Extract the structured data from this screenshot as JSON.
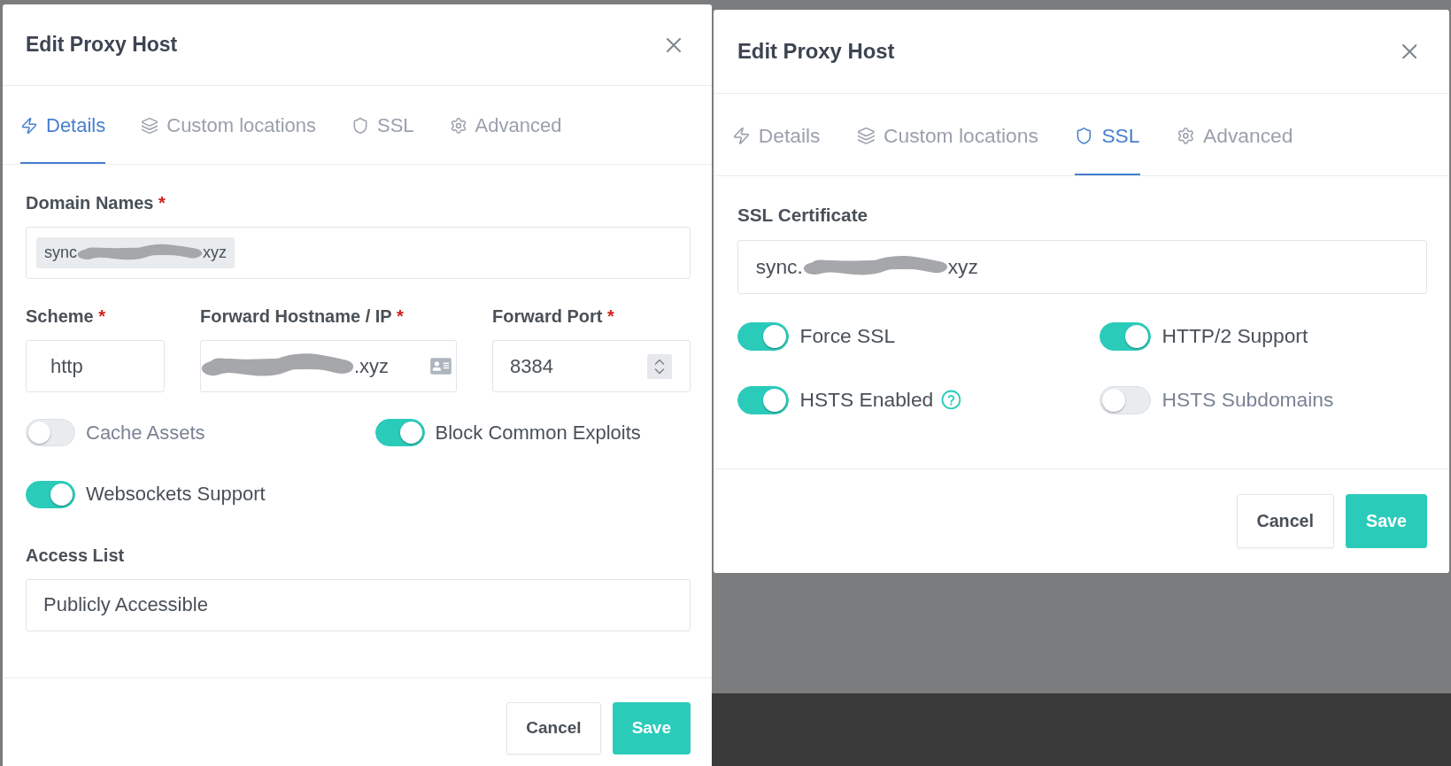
{
  "dialogs": [
    {
      "title": "Edit Proxy Host",
      "tabs": [
        {
          "label": "Details",
          "selected": true
        },
        {
          "label": "Custom locations",
          "selected": false
        },
        {
          "label": "SSL",
          "selected": false
        },
        {
          "label": "Advanced",
          "selected": false
        }
      ],
      "body": [
        {
          "kind": "tags",
          "label": "Domain Names",
          "required_mark": "*",
          "tags": [
            {
              "text_before": "sync",
              "text_after": "xyz",
              "redacted": true
            }
          ]
        },
        {
          "kind": "row",
          "fields": [
            {
              "kind": "select",
              "label": "Scheme",
              "required_mark": "*",
              "value": "http"
            },
            {
              "kind": "hostname",
              "label": "Forward Hostname / IP",
              "required_mark": "*",
              "text_after": ".xyz",
              "redacted": true
            },
            {
              "kind": "number",
              "label": "Forward Port",
              "required_mark": "*",
              "value": "8384"
            }
          ]
        },
        {
          "kind": "toggles",
          "toggles": [
            {
              "label": "Cache Assets",
              "on": false
            },
            {
              "label": "Block Common Exploits",
              "on": true
            },
            {
              "label": "Websockets Support",
              "on": true
            }
          ]
        },
        {
          "kind": "field",
          "label": "Access List",
          "value": "Publicly Accessible"
        }
      ],
      "buttons": [
        {
          "label": "Cancel",
          "kind": "secondary"
        },
        {
          "label": "Save",
          "kind": "primary"
        }
      ]
    },
    {
      "title": "Edit Proxy Host",
      "tabs": [
        {
          "label": "Details",
          "selected": false
        },
        {
          "label": "Custom locations",
          "selected": false
        },
        {
          "label": "SSL",
          "selected": true
        },
        {
          "label": "Advanced",
          "selected": false
        }
      ],
      "body": [
        {
          "kind": "field",
          "label": "SSL Certificate",
          "text_before": "sync.",
          "text_after": "xyz",
          "redacted": true
        },
        {
          "kind": "toggles",
          "toggles": [
            {
              "label": "Force SSL",
              "on": true
            },
            {
              "label": "HTTP/2 Support",
              "on": true
            },
            {
              "label": "HSTS Enabled",
              "on": true,
              "help": true
            },
            {
              "label": "HSTS Subdomains",
              "on": false
            }
          ]
        }
      ],
      "buttons": [
        {
          "label": "Cancel",
          "kind": "secondary"
        },
        {
          "label": "Save",
          "kind": "primary"
        }
      ]
    }
  ]
}
